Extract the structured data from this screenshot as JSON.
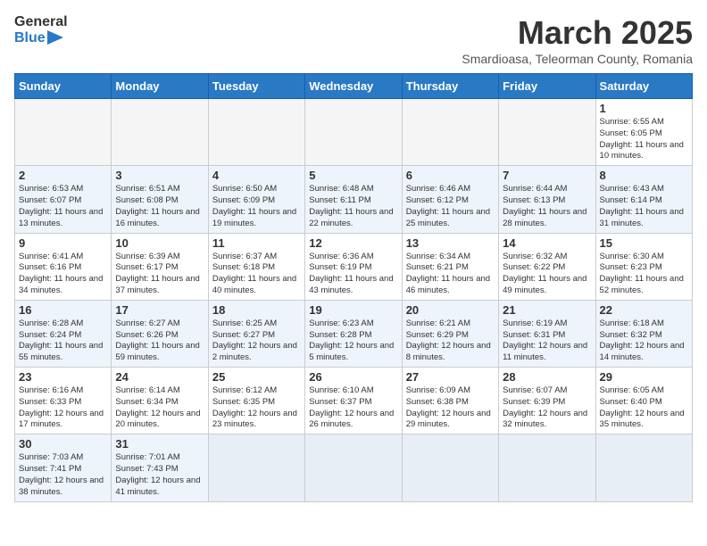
{
  "header": {
    "logo_general": "General",
    "logo_blue": "Blue",
    "month_title": "March 2025",
    "subtitle": "Smardioasa, Teleorman County, Romania"
  },
  "days_of_week": [
    "Sunday",
    "Monday",
    "Tuesday",
    "Wednesday",
    "Thursday",
    "Friday",
    "Saturday"
  ],
  "weeks": [
    {
      "days": [
        {
          "num": "",
          "info": ""
        },
        {
          "num": "",
          "info": ""
        },
        {
          "num": "",
          "info": ""
        },
        {
          "num": "",
          "info": ""
        },
        {
          "num": "",
          "info": ""
        },
        {
          "num": "",
          "info": ""
        },
        {
          "num": "1",
          "info": "Sunrise: 6:55 AM\nSunset: 6:05 PM\nDaylight: 11 hours and 10 minutes."
        }
      ]
    },
    {
      "days": [
        {
          "num": "2",
          "info": "Sunrise: 6:53 AM\nSunset: 6:07 PM\nDaylight: 11 hours and 13 minutes."
        },
        {
          "num": "3",
          "info": "Sunrise: 6:51 AM\nSunset: 6:08 PM\nDaylight: 11 hours and 16 minutes."
        },
        {
          "num": "4",
          "info": "Sunrise: 6:50 AM\nSunset: 6:09 PM\nDaylight: 11 hours and 19 minutes."
        },
        {
          "num": "5",
          "info": "Sunrise: 6:48 AM\nSunset: 6:11 PM\nDaylight: 11 hours and 22 minutes."
        },
        {
          "num": "6",
          "info": "Sunrise: 6:46 AM\nSunset: 6:12 PM\nDaylight: 11 hours and 25 minutes."
        },
        {
          "num": "7",
          "info": "Sunrise: 6:44 AM\nSunset: 6:13 PM\nDaylight: 11 hours and 28 minutes."
        },
        {
          "num": "8",
          "info": "Sunrise: 6:43 AM\nSunset: 6:14 PM\nDaylight: 11 hours and 31 minutes."
        }
      ]
    },
    {
      "days": [
        {
          "num": "9",
          "info": "Sunrise: 6:41 AM\nSunset: 6:16 PM\nDaylight: 11 hours and 34 minutes."
        },
        {
          "num": "10",
          "info": "Sunrise: 6:39 AM\nSunset: 6:17 PM\nDaylight: 11 hours and 37 minutes."
        },
        {
          "num": "11",
          "info": "Sunrise: 6:37 AM\nSunset: 6:18 PM\nDaylight: 11 hours and 40 minutes."
        },
        {
          "num": "12",
          "info": "Sunrise: 6:36 AM\nSunset: 6:19 PM\nDaylight: 11 hours and 43 minutes."
        },
        {
          "num": "13",
          "info": "Sunrise: 6:34 AM\nSunset: 6:21 PM\nDaylight: 11 hours and 46 minutes."
        },
        {
          "num": "14",
          "info": "Sunrise: 6:32 AM\nSunset: 6:22 PM\nDaylight: 11 hours and 49 minutes."
        },
        {
          "num": "15",
          "info": "Sunrise: 6:30 AM\nSunset: 6:23 PM\nDaylight: 11 hours and 52 minutes."
        }
      ]
    },
    {
      "days": [
        {
          "num": "16",
          "info": "Sunrise: 6:28 AM\nSunset: 6:24 PM\nDaylight: 11 hours and 55 minutes."
        },
        {
          "num": "17",
          "info": "Sunrise: 6:27 AM\nSunset: 6:26 PM\nDaylight: 11 hours and 59 minutes."
        },
        {
          "num": "18",
          "info": "Sunrise: 6:25 AM\nSunset: 6:27 PM\nDaylight: 12 hours and 2 minutes."
        },
        {
          "num": "19",
          "info": "Sunrise: 6:23 AM\nSunset: 6:28 PM\nDaylight: 12 hours and 5 minutes."
        },
        {
          "num": "20",
          "info": "Sunrise: 6:21 AM\nSunset: 6:29 PM\nDaylight: 12 hours and 8 minutes."
        },
        {
          "num": "21",
          "info": "Sunrise: 6:19 AM\nSunset: 6:31 PM\nDaylight: 12 hours and 11 minutes."
        },
        {
          "num": "22",
          "info": "Sunrise: 6:18 AM\nSunset: 6:32 PM\nDaylight: 12 hours and 14 minutes."
        }
      ]
    },
    {
      "days": [
        {
          "num": "23",
          "info": "Sunrise: 6:16 AM\nSunset: 6:33 PM\nDaylight: 12 hours and 17 minutes."
        },
        {
          "num": "24",
          "info": "Sunrise: 6:14 AM\nSunset: 6:34 PM\nDaylight: 12 hours and 20 minutes."
        },
        {
          "num": "25",
          "info": "Sunrise: 6:12 AM\nSunset: 6:35 PM\nDaylight: 12 hours and 23 minutes."
        },
        {
          "num": "26",
          "info": "Sunrise: 6:10 AM\nSunset: 6:37 PM\nDaylight: 12 hours and 26 minutes."
        },
        {
          "num": "27",
          "info": "Sunrise: 6:09 AM\nSunset: 6:38 PM\nDaylight: 12 hours and 29 minutes."
        },
        {
          "num": "28",
          "info": "Sunrise: 6:07 AM\nSunset: 6:39 PM\nDaylight: 12 hours and 32 minutes."
        },
        {
          "num": "29",
          "info": "Sunrise: 6:05 AM\nSunset: 6:40 PM\nDaylight: 12 hours and 35 minutes."
        }
      ]
    },
    {
      "days": [
        {
          "num": "30",
          "info": "Sunrise: 7:03 AM\nSunset: 7:41 PM\nDaylight: 12 hours and 38 minutes."
        },
        {
          "num": "31",
          "info": "Sunrise: 7:01 AM\nSunset: 7:43 PM\nDaylight: 12 hours and 41 minutes."
        },
        {
          "num": "",
          "info": ""
        },
        {
          "num": "",
          "info": ""
        },
        {
          "num": "",
          "info": ""
        },
        {
          "num": "",
          "info": ""
        },
        {
          "num": "",
          "info": ""
        }
      ]
    }
  ]
}
